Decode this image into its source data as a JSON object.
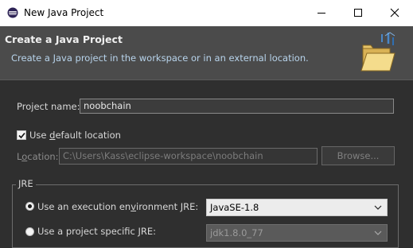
{
  "window": {
    "title": "New Java Project"
  },
  "header": {
    "title": "Create a Java Project",
    "description": "Create a Java project in the workspace or in an external location."
  },
  "form": {
    "project_name_label": "Project name:",
    "project_name_value": "noobchain",
    "use_default_location_pre": "Use ",
    "use_default_location_mnemonic": "d",
    "use_default_location_post": "efault location",
    "use_default_location_checked": true,
    "location_label_pre": "L",
    "location_label_mnemonic": "o",
    "location_label_post": "cation:",
    "location_value": "C:\\Users\\Kass\\eclipse-workspace\\noobchain",
    "browse_label": "Browse..."
  },
  "jre": {
    "group_label": "JRE",
    "option_env_pre": "Use an execution en",
    "option_env_mnemonic": "v",
    "option_env_post": "ironment JRE:",
    "option_env_selected": true,
    "env_value": "JavaSE-1.8",
    "option_specific_label": "Use a project specific JRE:",
    "specific_value": "jdk1.8.0_77"
  },
  "colors": {
    "header_bg": "#4b4b4b",
    "header_desc": "#b8d4ec",
    "body_bg": "#2f2f2f"
  }
}
